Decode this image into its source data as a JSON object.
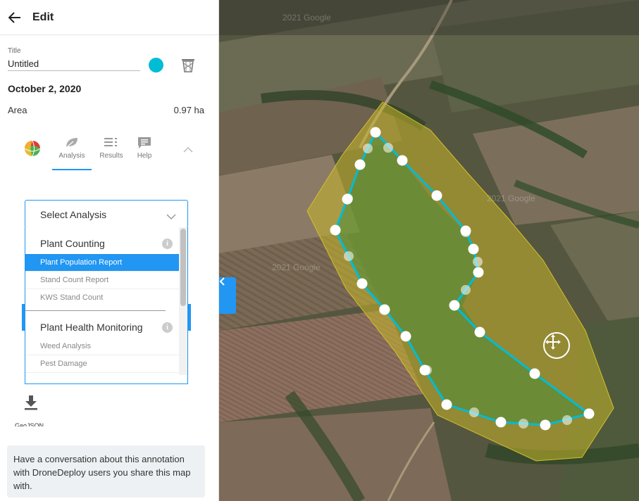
{
  "header": {
    "title": "Edit"
  },
  "annotation": {
    "title_label": "Title",
    "title_value": "Untitled",
    "color": "#00bcd4",
    "date": "October 2, 2020",
    "area_label": "Area",
    "area_value": "0.97 ha"
  },
  "tabs": [
    {
      "label": "Analysis",
      "icon": "leaf-icon",
      "active": true
    },
    {
      "label": "Results",
      "icon": "list-icon",
      "active": false
    },
    {
      "label": "Help",
      "icon": "chat-icon",
      "active": false
    }
  ],
  "analysis_select": {
    "placeholder": "Select Analysis",
    "groups": [
      {
        "label": "Plant Counting",
        "items": [
          "Plant Population Report",
          "Stand Count Report",
          "KWS Stand Count"
        ]
      },
      {
        "label": "Plant Health Monitoring",
        "items": [
          "Weed Analysis",
          "Pest Damage"
        ]
      }
    ],
    "highlighted": "Plant Population Report"
  },
  "export": {
    "label": "GeoJSON"
  },
  "conversation": {
    "text": "Have a conversation about this annotation with DroneDeploy users you share this map with."
  },
  "map": {
    "watermarks": [
      "2021 Google",
      "2021 Google",
      "2021 Google"
    ],
    "polygon_color": "#00bcd4",
    "field_color": "#d4c02a"
  }
}
